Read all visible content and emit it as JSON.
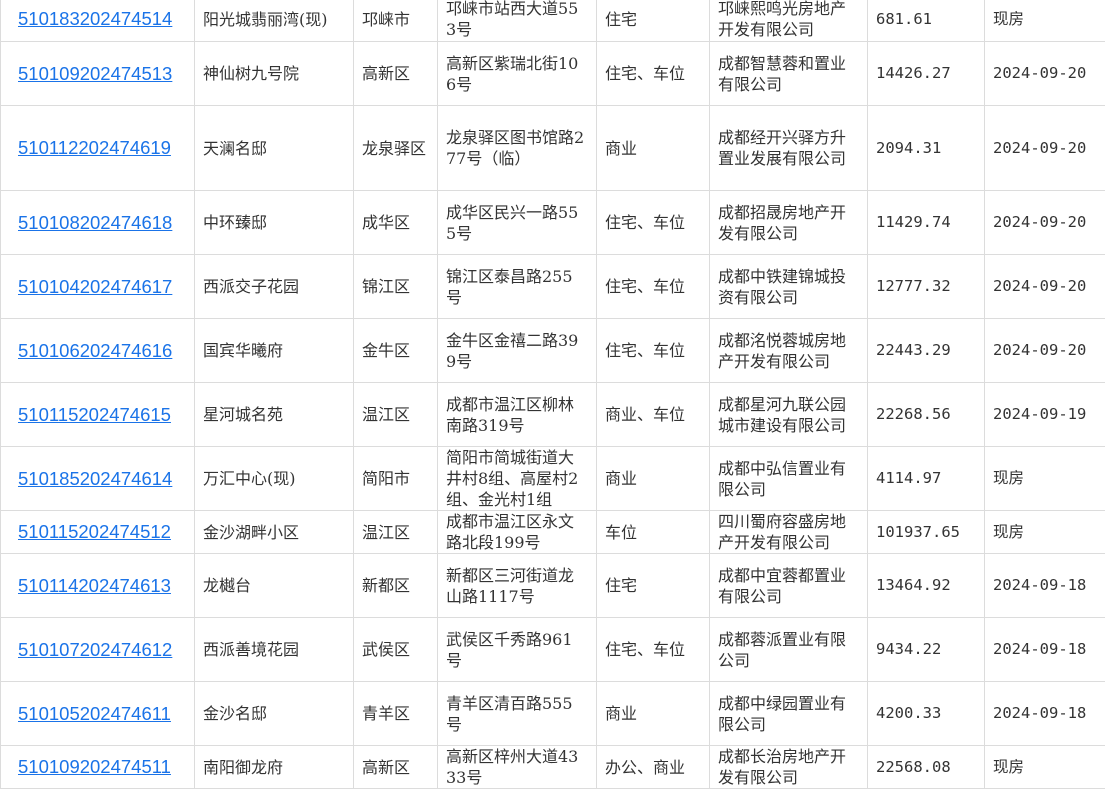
{
  "rows": [
    {
      "id": "510183202474514",
      "name": "阳光城翡丽湾(现)",
      "district": "邛崃市",
      "address": "邛崃市站西大道553号",
      "usage": "住宅",
      "developer": "邛崃熙鸣光房地产开发有限公司",
      "area": "681.61",
      "date": "现房"
    },
    {
      "id": "510109202474513",
      "name": "神仙树九号院",
      "district": "高新区",
      "address": "高新区紫瑞北街106号",
      "usage": "住宅、车位",
      "developer": "成都智慧蓉和置业有限公司",
      "area": "14426.27",
      "date": "2024-09-20"
    },
    {
      "id": "510112202474619",
      "name": "天澜名邸",
      "district": "龙泉驿区",
      "address": "龙泉驿区图书馆路277号（临）",
      "usage": "商业",
      "developer": "成都经开兴驿方升置业发展有限公司",
      "area": "2094.31",
      "date": "2024-09-20"
    },
    {
      "id": "510108202474618",
      "name": "中环臻邸",
      "district": "成华区",
      "address": "成华区民兴一路555号",
      "usage": "住宅、车位",
      "developer": "成都招晟房地产开发有限公司",
      "area": "11429.74",
      "date": "2024-09-20"
    },
    {
      "id": "510104202474617",
      "name": "西派交子花园",
      "district": "锦江区",
      "address": "锦江区泰昌路255号",
      "usage": "住宅、车位",
      "developer": "成都中铁建锦城投资有限公司",
      "area": "12777.32",
      "date": "2024-09-20"
    },
    {
      "id": "510106202474616",
      "name": "国宾华曦府",
      "district": "金牛区",
      "address": "金牛区金禧二路399号",
      "usage": "住宅、车位",
      "developer": "成都洺悦蓉城房地产开发有限公司",
      "area": "22443.29",
      "date": "2024-09-20"
    },
    {
      "id": "510115202474615",
      "name": "星河城名苑",
      "district": "温江区",
      "address": "成都市温江区柳林南路319号",
      "usage": "商业、车位",
      "developer": "成都星河九联公园城市建设有限公司",
      "area": "22268.56",
      "date": "2024-09-19"
    },
    {
      "id": "510185202474614",
      "name": "万汇中心(现)",
      "district": "简阳市",
      "address": "简阳市简城街道大井村8组、高屋村2组、金光村1组",
      "usage": "商业",
      "developer": "成都中弘信置业有限公司",
      "area": "4114.97",
      "date": "现房"
    },
    {
      "id": "510115202474512",
      "name": "金沙湖畔小区",
      "district": "温江区",
      "address": "成都市温江区永文路北段199号",
      "usage": "车位",
      "developer": "四川蜀府容盛房地产开发有限公司",
      "area": "101937.65",
      "date": "现房"
    },
    {
      "id": "510114202474613",
      "name": "龙樾台",
      "district": "新都区",
      "address": "新都区三河街道龙山路1117号",
      "usage": "住宅",
      "developer": "成都中宜蓉都置业有限公司",
      "area": "13464.92",
      "date": "2024-09-18"
    },
    {
      "id": "510107202474612",
      "name": "西派善境花园",
      "district": "武侯区",
      "address": "武侯区千秀路961号",
      "usage": "住宅、车位",
      "developer": "成都蓉派置业有限公司",
      "area": "9434.22",
      "date": "2024-09-18"
    },
    {
      "id": "510105202474611",
      "name": "金沙名邸",
      "district": "青羊区",
      "address": "青羊区清百路555号",
      "usage": "商业",
      "developer": "成都中绿园置业有限公司",
      "area": "4200.33",
      "date": "2024-09-18"
    },
    {
      "id": "510109202474511",
      "name": "南阳御龙府",
      "district": "高新区",
      "address": "高新区梓州大道4333号",
      "usage": "办公、商业",
      "developer": "成都长治房地产开发有限公司",
      "area": "22568.08",
      "date": "现房"
    }
  ]
}
